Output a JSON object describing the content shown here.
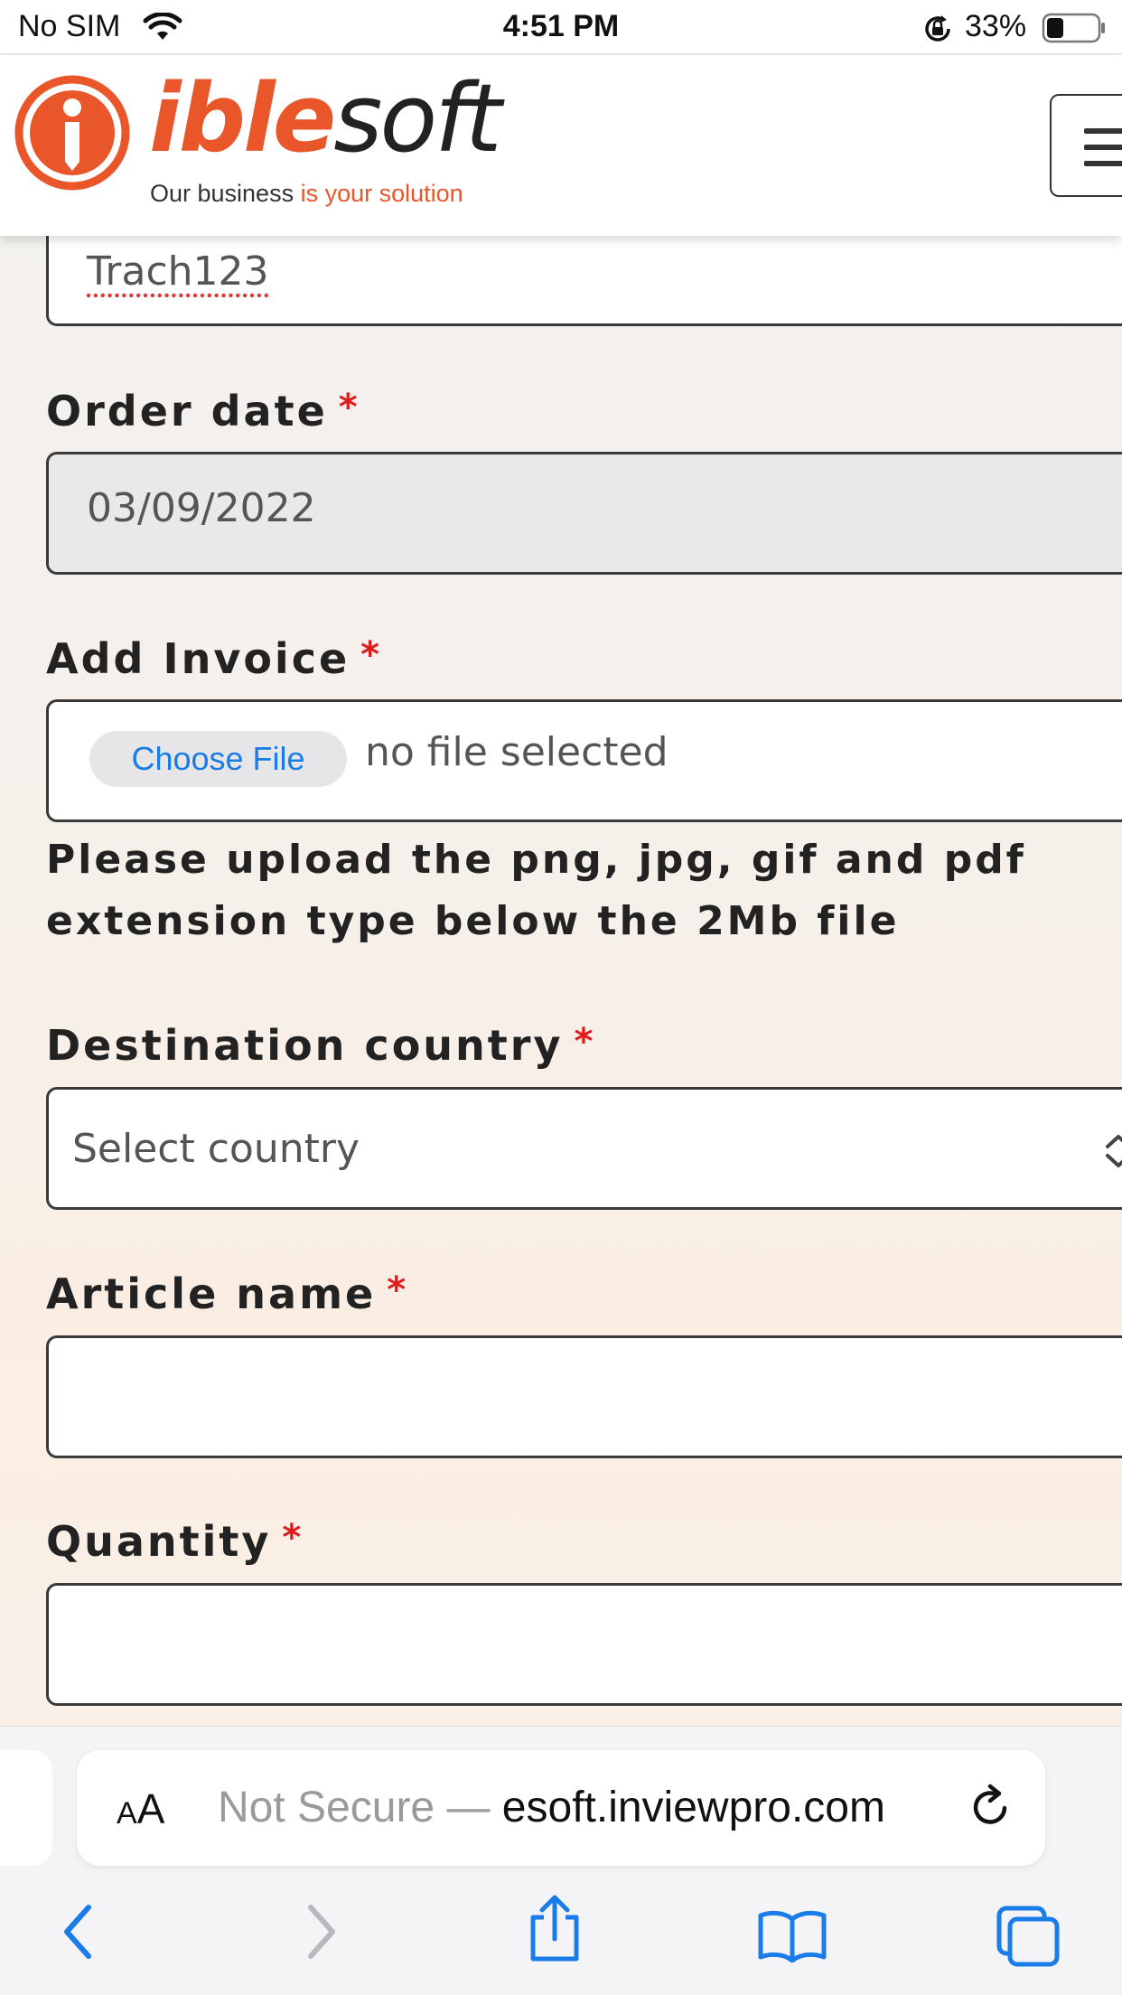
{
  "status_bar": {
    "carrier": "No SIM",
    "time": "4:51 PM",
    "battery": "33%",
    "battery_level": 0.33
  },
  "header": {
    "logo_part1": "ible",
    "logo_part2": "soft",
    "tagline_part1": "Our business ",
    "tagline_part2": "is your solution",
    "brand_color": "#e8562a",
    "menu_icon": "hamburger-icon"
  },
  "form": {
    "tracking_value": "Trach123",
    "order_date": {
      "label": "Order date",
      "required_mark": "*",
      "value": "03/09/2022"
    },
    "invoice": {
      "label": "Add Invoice",
      "required_mark": "*",
      "button_label": "Choose File",
      "file_status": "no file selected",
      "help_text": "Please upload the png, jpg, gif and pdf extension type below the 2Mb file"
    },
    "destination_country": {
      "label": "Destination country",
      "required_mark": "*",
      "selected": "Select country"
    },
    "article_name": {
      "label": "Article name",
      "required_mark": "*",
      "value": ""
    },
    "quantity": {
      "label": "Quantity",
      "required_mark": "*",
      "value": ""
    },
    "required_color": "#e01b1b"
  },
  "browser": {
    "text_size_small": "A",
    "text_size_big": "A",
    "security": "Not Secure — ",
    "host": "esoft.inviewpro.com",
    "toolbar": [
      "back-icon",
      "forward-icon",
      "share-icon",
      "bookmarks-icon",
      "tabs-icon"
    ],
    "accent_color": "#1a7ce8"
  }
}
